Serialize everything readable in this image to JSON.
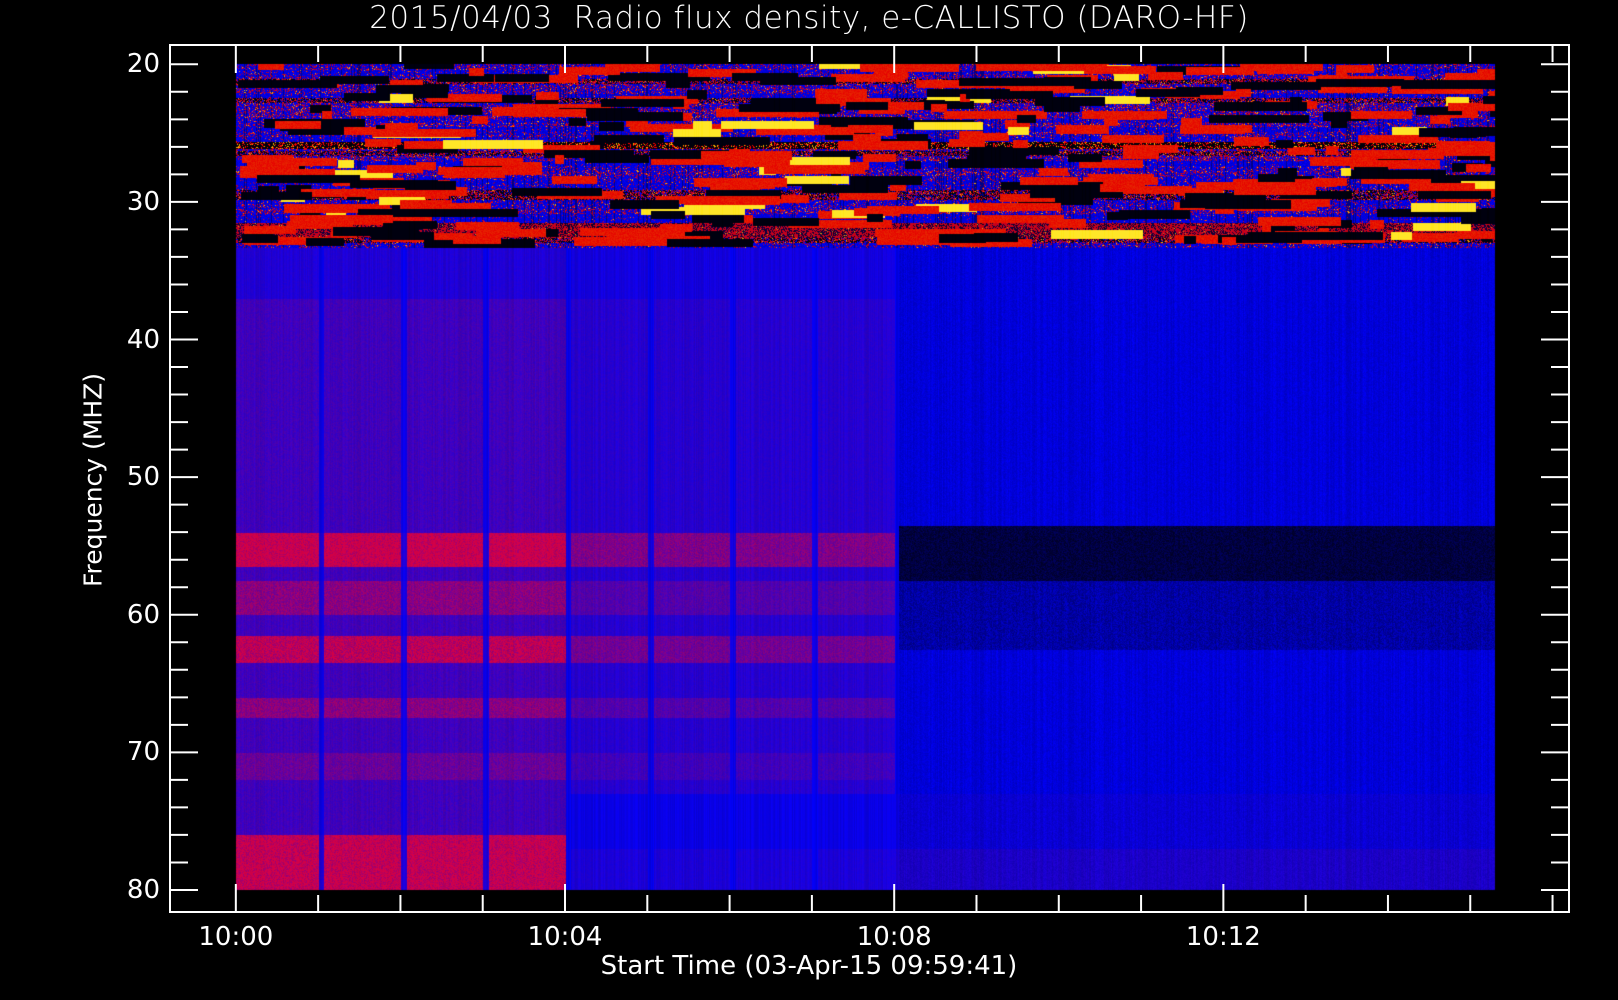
{
  "chart_data": {
    "type": "heatmap",
    "title": "2015/04/03  Radio flux density, e-CALLISTO (DARO-HF)",
    "xlabel": "Start Time (03-Apr-15 09:59:41)",
    "ylabel": "Frequency (MHZ)",
    "x_unit": "minutes after 10:00",
    "xlim": [
      -0.8,
      16.2
    ],
    "data_xrange": [
      0,
      15.3
    ],
    "x_ticks": [
      {
        "value": 0,
        "label": "10:00"
      },
      {
        "value": 4,
        "label": "10:04"
      },
      {
        "value": 8,
        "label": "10:08"
      },
      {
        "value": 12,
        "label": "10:12"
      }
    ],
    "x_minor_step": 1,
    "ylim": [
      18.6,
      81.6
    ],
    "y_inverted": true,
    "data_yrange": [
      20,
      80
    ],
    "y_ticks": [
      {
        "value": 20,
        "label": "20"
      },
      {
        "value": 30,
        "label": "30"
      },
      {
        "value": 40,
        "label": "40"
      },
      {
        "value": 50,
        "label": "50"
      },
      {
        "value": 60,
        "label": "60"
      },
      {
        "value": 70,
        "label": "70"
      },
      {
        "value": 80,
        "label": "80"
      }
    ],
    "y_minor_step": 2,
    "colormap": [
      "#000000",
      "#0000ff",
      "#c00000",
      "#ff3000",
      "#ffff00"
    ],
    "features": {
      "rfi_band_mhz": [
        20,
        33
      ],
      "enhanced_bands_before_10_08_mhz": [
        [
          54,
          56.5
        ],
        [
          57.5,
          60
        ],
        [
          61.5,
          63.5
        ],
        [
          66,
          67.5
        ],
        [
          70,
          72
        ],
        [
          77,
          80
        ]
      ],
      "background_step_minutes": [
        4,
        8
      ],
      "dark_band_after_10_08_mhz": [
        53.5,
        57.5
      ]
    }
  }
}
